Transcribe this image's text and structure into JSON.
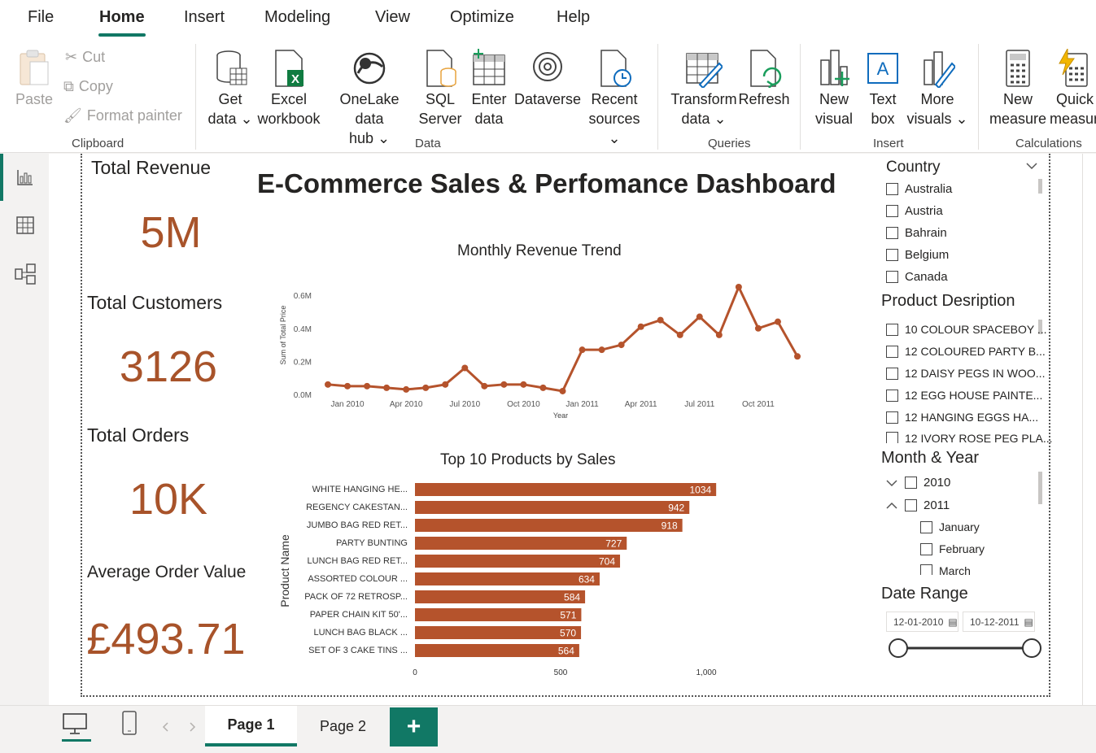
{
  "menu": {
    "items": [
      "File",
      "Home",
      "Insert",
      "Modeling",
      "View",
      "Optimize",
      "Help"
    ],
    "active": "Home"
  },
  "ribbon": {
    "clipboard": {
      "paste": "Paste",
      "cut": "Cut",
      "copy": "Copy",
      "format_painter": "Format painter",
      "group": "Clipboard"
    },
    "data": {
      "get_data": [
        "Get",
        "data ⌄"
      ],
      "excel": [
        "Excel",
        "workbook"
      ],
      "onelake": [
        "OneLake data",
        "hub ⌄"
      ],
      "sql": [
        "SQL",
        "Server"
      ],
      "enter": [
        "Enter",
        "data"
      ],
      "dataverse": [
        "Dataverse",
        ""
      ],
      "recent": [
        "Recent",
        "sources ⌄"
      ],
      "group": "Data"
    },
    "queries": {
      "transform": [
        "Transform",
        "data ⌄"
      ],
      "refresh": [
        "Refresh",
        ""
      ],
      "group": "Queries"
    },
    "insert": {
      "new_visual": [
        "New",
        "visual"
      ],
      "text_box": [
        "Text",
        "box"
      ],
      "more_visuals": [
        "More",
        "visuals ⌄"
      ],
      "group": "Insert"
    },
    "calculations": {
      "new_measure": [
        "New",
        "measure"
      ],
      "quick_measure": [
        "Quick",
        "measure"
      ],
      "group": "Calculations"
    }
  },
  "kpis": {
    "revenue_label": "Total Revenue",
    "revenue_value": "5M",
    "customers_label": "Total Customers",
    "customers_value": "3126",
    "orders_label": "Total Orders",
    "orders_value": "10K",
    "aov_label": "Average Order Value",
    "aov_value": "£493.71"
  },
  "dashboard_title": "E-Commerce Sales & Perfomance Dashboard",
  "line_chart": {
    "title": "Monthly Revenue Trend",
    "ylabel": "Sum of Total Price",
    "xlabel": "Year",
    "y_ticks": [
      "0.0M",
      "0.2M",
      "0.4M",
      "0.6M"
    ],
    "x_ticks": [
      "Jan 2010",
      "Apr 2010",
      "Jul 2010",
      "Oct 2010",
      "Jan 2011",
      "Apr 2011",
      "Jul 2011",
      "Oct 2011"
    ],
    "color": "#b5532c"
  },
  "bar_chart": {
    "title": "Top 10 Products by Sales",
    "ylabel": "Product Name",
    "x_ticks": [
      "0",
      "500",
      "1,000"
    ],
    "color": "#b5532c"
  },
  "chart_data": [
    {
      "type": "line",
      "title": "Monthly Revenue Trend",
      "xlabel": "Year",
      "ylabel": "Sum of Total Price",
      "x": [
        "Dec 2009",
        "Jan 2010",
        "Feb 2010",
        "Mar 2010",
        "Apr 2010",
        "May 2010",
        "Jun 2010",
        "Jul 2010",
        "Aug 2010",
        "Sep 2010",
        "Oct 2010",
        "Nov 2010",
        "Dec 2010",
        "Jan 2011",
        "Feb 2011",
        "Mar 2011",
        "Apr 2011",
        "May 2011",
        "Jun 2011",
        "Jul 2011",
        "Aug 2011",
        "Sep 2011",
        "Oct 2011",
        "Nov 2011",
        "Dec 2011"
      ],
      "values": [
        0.06,
        0.05,
        0.05,
        0.04,
        0.03,
        0.04,
        0.06,
        0.16,
        0.05,
        0.06,
        0.06,
        0.04,
        0.02,
        0.27,
        0.27,
        0.3,
        0.41,
        0.45,
        0.36,
        0.47,
        0.36,
        0.65,
        0.4,
        0.44,
        0.23
      ],
      "ylim": [
        0,
        0.65
      ],
      "unit": "M"
    },
    {
      "type": "bar",
      "title": "Top 10 Products by Sales",
      "ylabel": "Product Name",
      "categories": [
        "WHITE HANGING HE...",
        "REGENCY CAKESTAN...",
        "JUMBO BAG RED RET...",
        "PARTY BUNTING",
        "LUNCH BAG RED RET...",
        "ASSORTED COLOUR ...",
        "PACK OF 72 RETROSP...",
        "PAPER CHAIN KIT 50'...",
        "LUNCH BAG BLACK ...",
        "SET OF 3 CAKE TINS ..."
      ],
      "values": [
        1034,
        942,
        918,
        727,
        704,
        634,
        584,
        571,
        570,
        564
      ],
      "xlim": [
        0,
        1000
      ]
    }
  ],
  "slicers": {
    "country": {
      "title": "Country",
      "items": [
        "Australia",
        "Austria",
        "Bahrain",
        "Belgium",
        "Canada"
      ]
    },
    "product": {
      "title": "Product Desription",
      "items": [
        "10 COLOUR SPACEBOY ...",
        "12 COLOURED PARTY B...",
        "12 DAISY PEGS IN WOO...",
        "12 EGG HOUSE PAINTE...",
        "12 HANGING EGGS HA...",
        "12 IVORY ROSE PEG PLA..."
      ]
    },
    "month_year": {
      "title": "Month & Year",
      "years": [
        "2010",
        "2011"
      ],
      "months": [
        "January",
        "February",
        "March"
      ]
    },
    "date_range": {
      "title": "Date Range",
      "start": "12-01-2010",
      "end": "10-12-2011"
    }
  },
  "pages": {
    "tabs": [
      "Page 1",
      "Page 2"
    ],
    "active": "Page 1",
    "add": "+"
  }
}
